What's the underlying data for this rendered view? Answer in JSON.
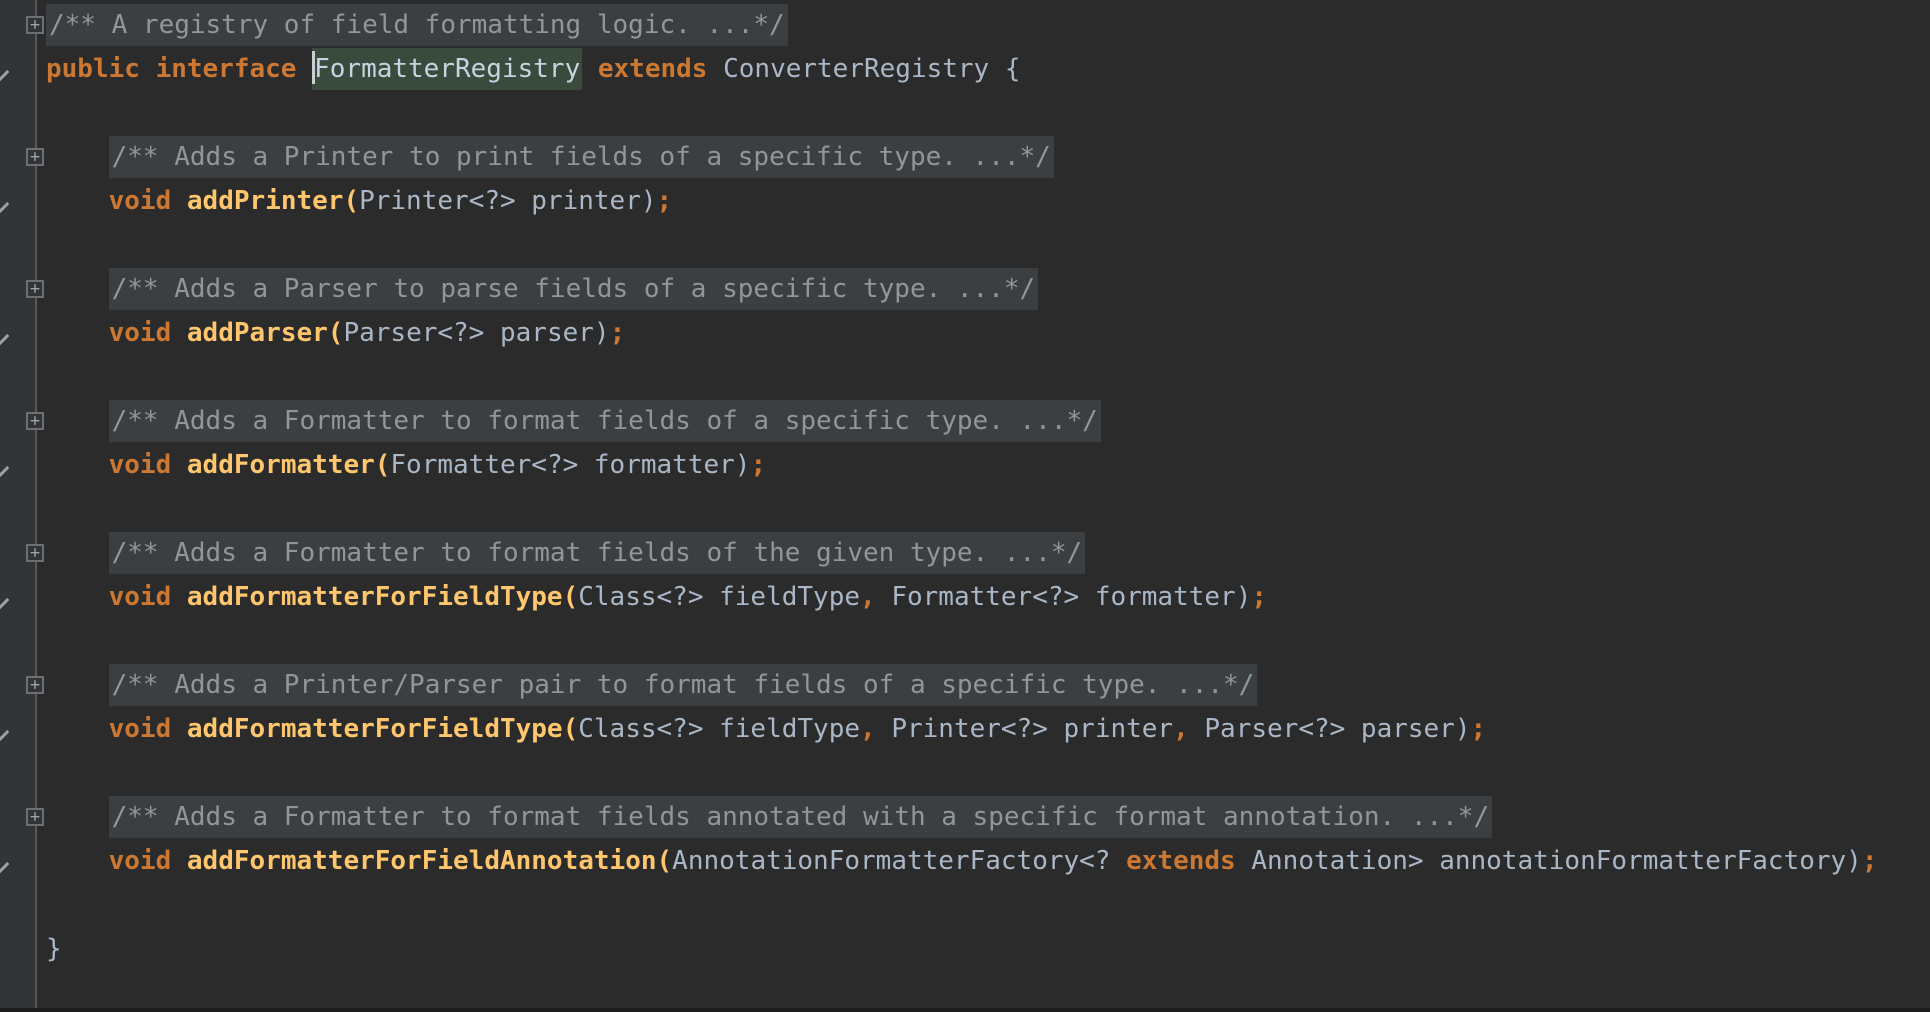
{
  "app": {
    "kind": "code-editor",
    "language": "java",
    "colors": {
      "editor_bg": "#2b2b2b",
      "gutter_bg": "#323438",
      "gutter_line": "#55585a",
      "keyword": "#cc7832",
      "method_name": "#ffc66d",
      "identifier": "#a9b7c6",
      "punctuation": "#cc7832",
      "comment_text": "#8f979b",
      "comment_fold_bg": "#3c3f41",
      "usage_highlight_bg": "#3a4b3d",
      "usage_highlight_text": "#c6d3e0",
      "caret": "#c9ced3"
    },
    "icons": {
      "fold_collapsed_plus": "+",
      "fold_expanded_chevron": "chevron-down"
    }
  },
  "editor": {
    "lines": [
      {
        "gutter": "plus",
        "tokens": [
          {
            "c": "cmt",
            "t": "/** A registry of field formatting logic. ...*/"
          }
        ]
      },
      {
        "gutter": "chevron",
        "tokens": [
          {
            "c": "kw",
            "t": "public interface"
          },
          {
            "c": "pln",
            "t": " "
          },
          {
            "c": "caret",
            "t": ""
          },
          {
            "c": "hl",
            "t": "FormatterRegistry"
          },
          {
            "c": "pln",
            "t": " "
          },
          {
            "c": "kw",
            "t": "extends"
          },
          {
            "c": "pln",
            "t": " ConverterRegistry {"
          }
        ]
      },
      {
        "gutter": null,
        "tokens": []
      },
      {
        "gutter": "plus",
        "tokens": [
          {
            "c": "ws",
            "t": "    "
          },
          {
            "c": "cmt",
            "t": "/** Adds a Printer to print fields of a specific type. ...*/"
          }
        ]
      },
      {
        "gutter": "chevron",
        "tokens": [
          {
            "c": "ws",
            "t": "    "
          },
          {
            "c": "kw",
            "t": "void"
          },
          {
            "c": "pln",
            "t": " "
          },
          {
            "c": "mth",
            "t": "addPrinter("
          },
          {
            "c": "pln",
            "t": "Printer<?> printer)"
          },
          {
            "c": "pct",
            "t": ";"
          }
        ]
      },
      {
        "gutter": null,
        "tokens": []
      },
      {
        "gutter": "plus",
        "tokens": [
          {
            "c": "ws",
            "t": "    "
          },
          {
            "c": "cmt",
            "t": "/** Adds a Parser to parse fields of a specific type. ...*/"
          }
        ]
      },
      {
        "gutter": "chevron",
        "tokens": [
          {
            "c": "ws",
            "t": "    "
          },
          {
            "c": "kw",
            "t": "void"
          },
          {
            "c": "pln",
            "t": " "
          },
          {
            "c": "mth",
            "t": "addParser("
          },
          {
            "c": "pln",
            "t": "Parser<?> parser)"
          },
          {
            "c": "pct",
            "t": ";"
          }
        ]
      },
      {
        "gutter": null,
        "tokens": []
      },
      {
        "gutter": "plus",
        "tokens": [
          {
            "c": "ws",
            "t": "    "
          },
          {
            "c": "cmt",
            "t": "/** Adds a Formatter to format fields of a specific type. ...*/"
          }
        ]
      },
      {
        "gutter": "chevron",
        "tokens": [
          {
            "c": "ws",
            "t": "    "
          },
          {
            "c": "kw",
            "t": "void"
          },
          {
            "c": "pln",
            "t": " "
          },
          {
            "c": "mth",
            "t": "addFormatter("
          },
          {
            "c": "pln",
            "t": "Formatter<?> formatter)"
          },
          {
            "c": "pct",
            "t": ";"
          }
        ]
      },
      {
        "gutter": null,
        "tokens": []
      },
      {
        "gutter": "plus",
        "tokens": [
          {
            "c": "ws",
            "t": "    "
          },
          {
            "c": "cmt",
            "t": "/** Adds a Formatter to format fields of the given type. ...*/"
          }
        ]
      },
      {
        "gutter": "chevron",
        "tokens": [
          {
            "c": "ws",
            "t": "    "
          },
          {
            "c": "kw",
            "t": "void"
          },
          {
            "c": "pln",
            "t": " "
          },
          {
            "c": "mth",
            "t": "addFormatterForFieldType("
          },
          {
            "c": "pln",
            "t": "Class<?> fieldType"
          },
          {
            "c": "pct",
            "t": ","
          },
          {
            "c": "pln",
            "t": " Formatter<?> formatter)"
          },
          {
            "c": "pct",
            "t": ";"
          }
        ]
      },
      {
        "gutter": null,
        "tokens": []
      },
      {
        "gutter": "plus",
        "tokens": [
          {
            "c": "ws",
            "t": "    "
          },
          {
            "c": "cmt",
            "t": "/** Adds a Printer/Parser pair to format fields of a specific type. ...*/"
          }
        ]
      },
      {
        "gutter": "chevron",
        "tokens": [
          {
            "c": "ws",
            "t": "    "
          },
          {
            "c": "kw",
            "t": "void"
          },
          {
            "c": "pln",
            "t": " "
          },
          {
            "c": "mth",
            "t": "addFormatterForFieldType("
          },
          {
            "c": "pln",
            "t": "Class<?> fieldType"
          },
          {
            "c": "pct",
            "t": ","
          },
          {
            "c": "pln",
            "t": " Printer<?> printer"
          },
          {
            "c": "pct",
            "t": ","
          },
          {
            "c": "pln",
            "t": " Parser<?> parser)"
          },
          {
            "c": "pct",
            "t": ";"
          }
        ]
      },
      {
        "gutter": null,
        "tokens": []
      },
      {
        "gutter": "plus",
        "tokens": [
          {
            "c": "ws",
            "t": "    "
          },
          {
            "c": "cmt",
            "t": "/** Adds a Formatter to format fields annotated with a specific format annotation. ...*/"
          }
        ]
      },
      {
        "gutter": "chevron",
        "tokens": [
          {
            "c": "ws",
            "t": "    "
          },
          {
            "c": "kw",
            "t": "void"
          },
          {
            "c": "pln",
            "t": " "
          },
          {
            "c": "mth",
            "t": "addFormatterForFieldAnnotation("
          },
          {
            "c": "pln",
            "t": "AnnotationFormatterFactory<? "
          },
          {
            "c": "kw",
            "t": "extends"
          },
          {
            "c": "pln",
            "t": " Annotation> annotationFormatterFactory)"
          },
          {
            "c": "pct",
            "t": ";"
          }
        ]
      },
      {
        "gutter": null,
        "tokens": []
      },
      {
        "gutter": null,
        "tokens": [
          {
            "c": "pln",
            "t": "}"
          }
        ]
      }
    ]
  }
}
